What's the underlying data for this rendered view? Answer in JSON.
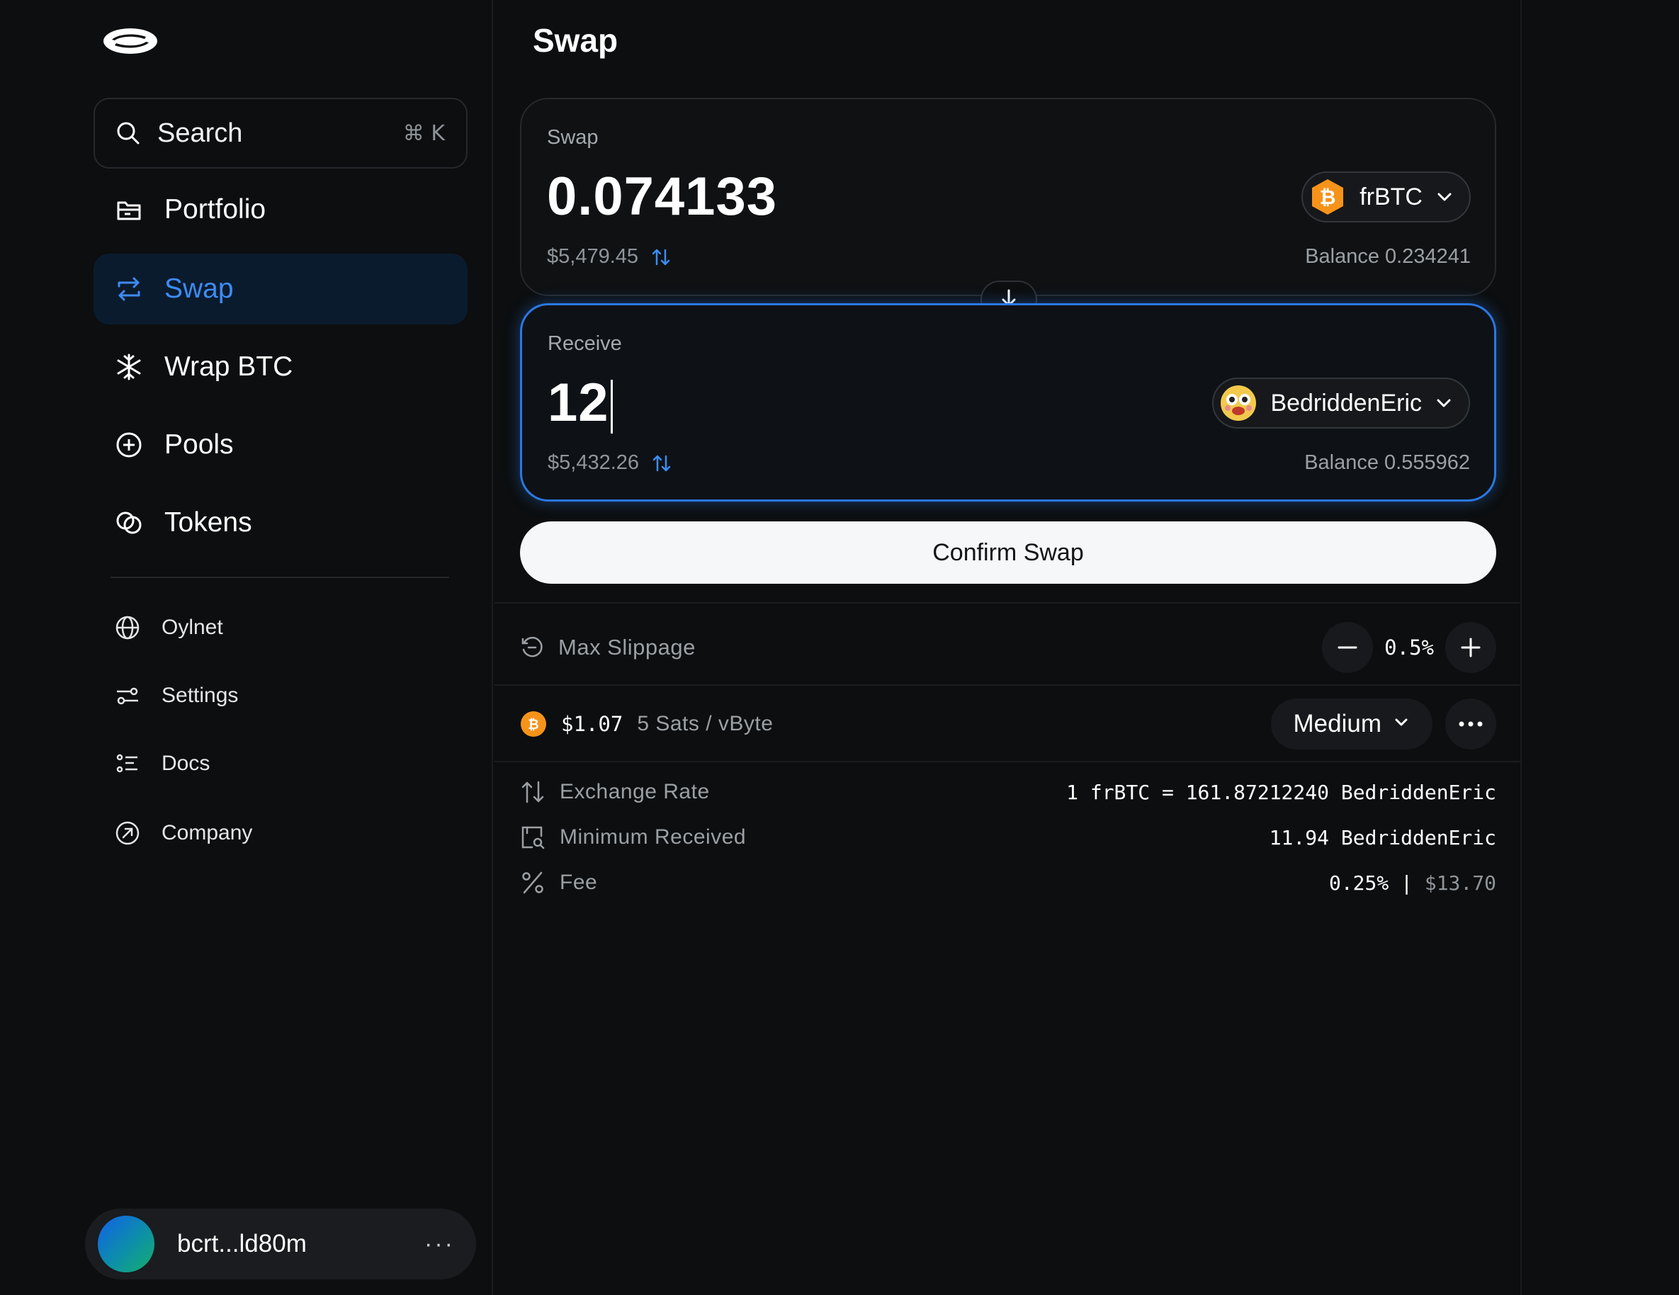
{
  "sidebar": {
    "search": {
      "label": "Search",
      "shortcut": "⌘ K"
    },
    "nav": [
      {
        "label": "Portfolio",
        "icon": "portfolio-icon"
      },
      {
        "label": "Swap",
        "icon": "swap-arrows-icon",
        "active": true
      },
      {
        "label": "Wrap BTC",
        "icon": "snowflake-icon"
      },
      {
        "label": "Pools",
        "icon": "plus-circle-icon"
      },
      {
        "label": "Tokens",
        "icon": "tokens-icon"
      }
    ],
    "secondary": [
      {
        "label": "Oylnet",
        "icon": "globe-icon"
      },
      {
        "label": "Settings",
        "icon": "sliders-icon"
      },
      {
        "label": "Docs",
        "icon": "list-icon"
      },
      {
        "label": "Company",
        "icon": "arrow-circle-icon"
      }
    ],
    "account": {
      "address": "bcrt...ld80m",
      "more": "···"
    }
  },
  "main": {
    "title": "Swap",
    "swap_card": {
      "caption": "Swap",
      "amount": "0.074133",
      "usd": "$5,479.45",
      "token": "frBTC",
      "balance": "Balance 0.234241"
    },
    "receive_card": {
      "caption": "Receive",
      "amount": "12",
      "usd": "$5,432.26",
      "token": "BedriddenEric",
      "balance": "Balance 0.555962"
    },
    "confirm_label": "Confirm Swap",
    "slippage": {
      "label": "Max Slippage",
      "value": "0.5%"
    },
    "network_fee": {
      "usd": "$1.07",
      "rate": "5 Sats / vByte",
      "speed": "Medium"
    },
    "details": {
      "exchange_rate": {
        "label": "Exchange Rate",
        "value": "1 frBTC = 161.87212240 BedriddenEric"
      },
      "minimum_received": {
        "label": "Minimum Received",
        "value": "11.94 BedriddenEric"
      },
      "fee": {
        "label": "Fee",
        "percent": "0.25%",
        "sep": "|",
        "usd": "$13.70"
      }
    }
  },
  "colors": {
    "accent": "#3d8cf4",
    "btc_orange": "#f7931a",
    "background": "#0c0e0f"
  }
}
